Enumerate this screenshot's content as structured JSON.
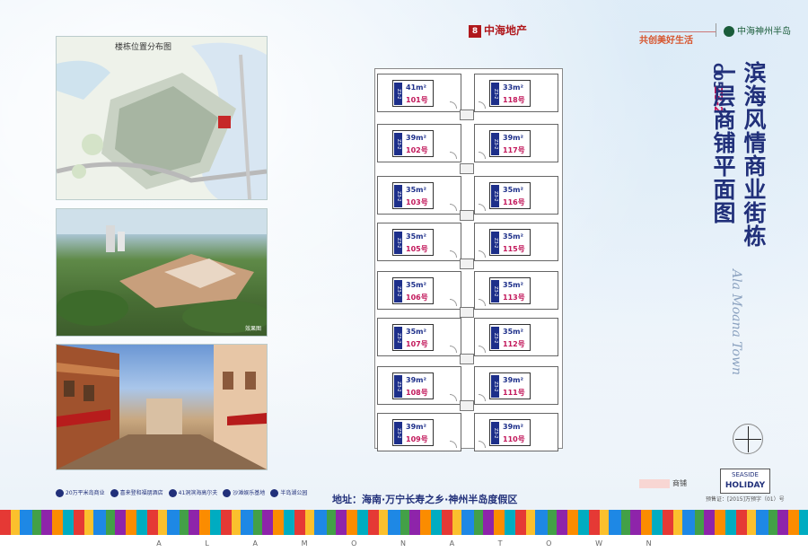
{
  "header": {
    "brand_logo": "8",
    "brand_developer": "中海地产",
    "brand_slogan": "共创美好生活",
    "brand_project": "中海神州半岛",
    "colors": {
      "developer": "#b0181c",
      "slogan": "#d7542c",
      "project": "#1a5c3a"
    }
  },
  "left": {
    "map_title": "楼栋位置分布图",
    "aerial_note": "效果图"
  },
  "plan": {
    "units": [
      {
        "area": "41m²",
        "num": "101号"
      },
      {
        "area": "33m²",
        "num": "118号"
      },
      {
        "area": "39m²",
        "num": "102号"
      },
      {
        "area": "39m²",
        "num": "117号"
      },
      {
        "area": "35m²",
        "num": "103号"
      },
      {
        "area": "35m²",
        "num": "116号"
      },
      {
        "area": "35m²",
        "num": "105号"
      },
      {
        "area": "35m²",
        "num": "115号"
      },
      {
        "area": "35m²",
        "num": "106号"
      },
      {
        "area": "35m²",
        "num": "113号"
      },
      {
        "area": "35m²",
        "num": "107号"
      },
      {
        "area": "35m²",
        "num": "112号"
      },
      {
        "area": "39m²",
        "num": "108号"
      },
      {
        "area": "39m²",
        "num": "111号"
      },
      {
        "area": "39m²",
        "num": "109号"
      },
      {
        "area": "39m²",
        "num": "110号"
      }
    ],
    "badge_text": "Z3-2",
    "color_badge": "#1d2f8a",
    "color_num": "#c2185b"
  },
  "title": {
    "code": "C05",
    "subcode": "Z3-2",
    "main": "滨海风情商业街栋一层商铺平面图",
    "script": "Ala Moana Town",
    "color": "#21307a"
  },
  "legend": {
    "label": "商铺"
  },
  "badge": {
    "line1": "SEASIDE",
    "line2": "HOLIDAY"
  },
  "permit": "预售证：[2015]万预字（01）号",
  "features": [
    "20万平米岛商业",
    "喜来登和福朋酒店",
    "41洞滨海高尔夫",
    "沙滩娱乐基地",
    "半岛湖公园"
  ],
  "address": "地址：海南·万宁长寿之乡·神州半岛度假区",
  "bottom_letters": [
    "A",
    "L",
    "A",
    "M",
    "O",
    "N",
    "A",
    "T",
    "O",
    "W",
    "N"
  ]
}
